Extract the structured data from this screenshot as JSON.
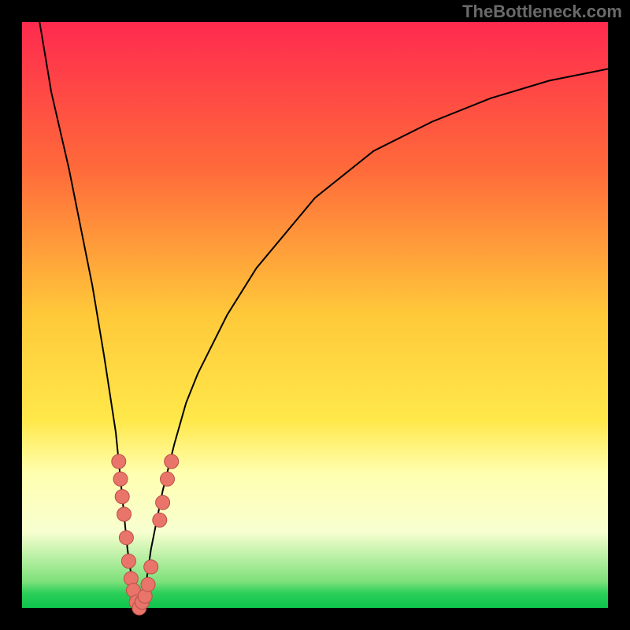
{
  "watermark": "TheBottleneck.com",
  "chart_data": {
    "type": "line",
    "title": "",
    "xlabel": "",
    "ylabel": "",
    "xlim": [
      0,
      100
    ],
    "ylim": [
      0,
      100
    ],
    "grid": false,
    "background": "vertical_gradient_red_to_green",
    "series": [
      {
        "name": "bottleneck-curve",
        "x": [
          3,
          5,
          8,
          10,
          12,
          14,
          16,
          17,
          18,
          19,
          20,
          21,
          22,
          24,
          26,
          28,
          30,
          35,
          40,
          50,
          60,
          70,
          80,
          90,
          100
        ],
        "y": [
          100,
          88,
          75,
          65,
          55,
          43,
          30,
          20,
          10,
          3,
          0,
          3,
          10,
          20,
          28,
          35,
          40,
          50,
          58,
          70,
          78,
          83,
          87,
          90,
          92
        ]
      }
    ],
    "markers": [
      {
        "x": 16.5,
        "y": 25
      },
      {
        "x": 16.8,
        "y": 22
      },
      {
        "x": 17.1,
        "y": 19
      },
      {
        "x": 17.4,
        "y": 16
      },
      {
        "x": 17.8,
        "y": 12
      },
      {
        "x": 18.2,
        "y": 8
      },
      {
        "x": 18.6,
        "y": 5
      },
      {
        "x": 19.0,
        "y": 3
      },
      {
        "x": 19.5,
        "y": 1
      },
      {
        "x": 20.0,
        "y": 0
      },
      {
        "x": 20.5,
        "y": 1
      },
      {
        "x": 21.0,
        "y": 2
      },
      {
        "x": 21.5,
        "y": 4
      },
      {
        "x": 22.0,
        "y": 7
      },
      {
        "x": 23.5,
        "y": 15
      },
      {
        "x": 24.0,
        "y": 18
      },
      {
        "x": 24.8,
        "y": 22
      },
      {
        "x": 25.5,
        "y": 25
      }
    ],
    "green_band_top": 97,
    "pale_band_top": 77,
    "pale_band_bottom": 97
  },
  "colors": {
    "frame": "#000000",
    "curve": "#000000",
    "marker_fill": "#e8746a",
    "marker_stroke": "#b84f47",
    "watermark": "#6a6a6a",
    "grad_top": "#ff2a4f",
    "grad_mid1": "#ff6a3a",
    "grad_mid2": "#ffc93a",
    "grad_mid3": "#ffe84a",
    "grad_pale": "#ffffb0",
    "grad_pale2": "#f8ffd0",
    "grad_green1": "#7de07a",
    "grad_green2": "#2bcf5a",
    "grad_green3": "#0ec44b"
  }
}
